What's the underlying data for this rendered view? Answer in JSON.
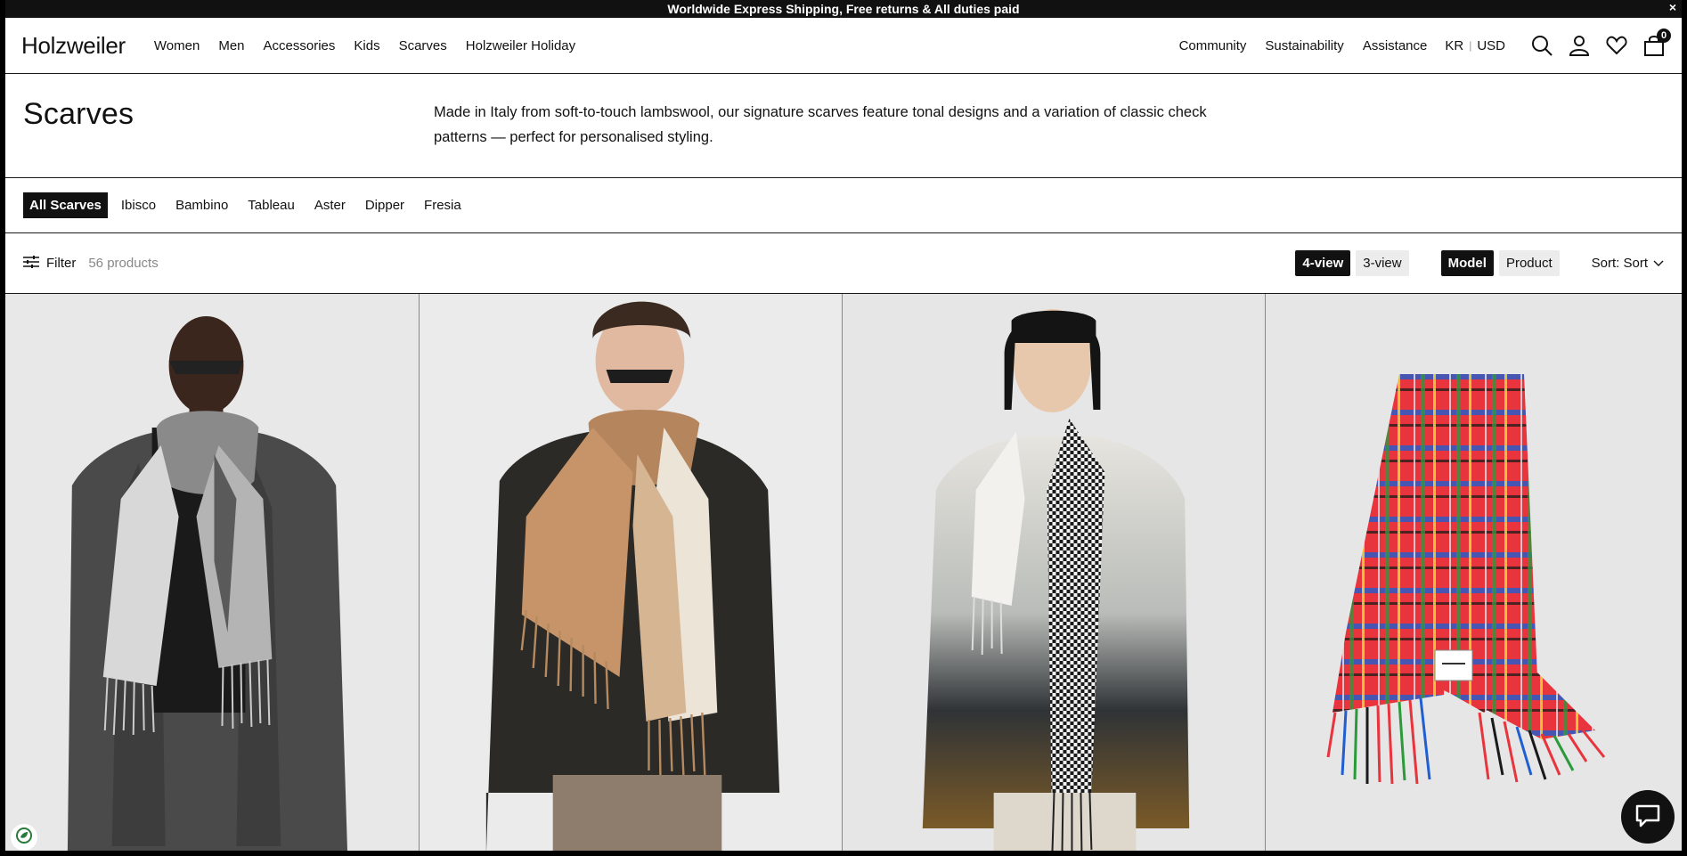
{
  "announcement": {
    "text": "Worldwide Express Shipping, Free returns & All duties paid",
    "close_label": "×"
  },
  "header": {
    "logo": "Holzweiler",
    "nav": [
      "Women",
      "Men",
      "Accessories",
      "Kids",
      "Scarves",
      "Holzweiler Holiday"
    ],
    "utility": [
      "Community",
      "Sustainability",
      "Assistance"
    ],
    "locale": {
      "country": "KR",
      "currency": "USD"
    },
    "cart_count": "0",
    "icons": [
      "search-icon",
      "account-icon",
      "heart-icon",
      "bag-icon"
    ]
  },
  "hero": {
    "title": "Scarves",
    "description": "Made in Italy from soft-to-touch lambswool, our signature scarves feature tonal designs and a variation of classic check patterns — perfect for personalised styling."
  },
  "subcategories": {
    "items": [
      "All Scarves",
      "Ibisco",
      "Bambino",
      "Tableau",
      "Aster",
      "Dipper",
      "Fresia"
    ],
    "active": "All Scarves"
  },
  "toolbar": {
    "filter_label": "Filter",
    "count": "56 products",
    "view_options": [
      "4-view",
      "3-view"
    ],
    "view_active": "4-view",
    "image_options": [
      "Model",
      "Product"
    ],
    "image_active": "Model",
    "sort_label": "Sort: Sort"
  },
  "colors": {
    "text": "#111111",
    "background": "#ffffff",
    "pill_inactive": "#ececec",
    "photo_bg": "#e6e6e6"
  }
}
